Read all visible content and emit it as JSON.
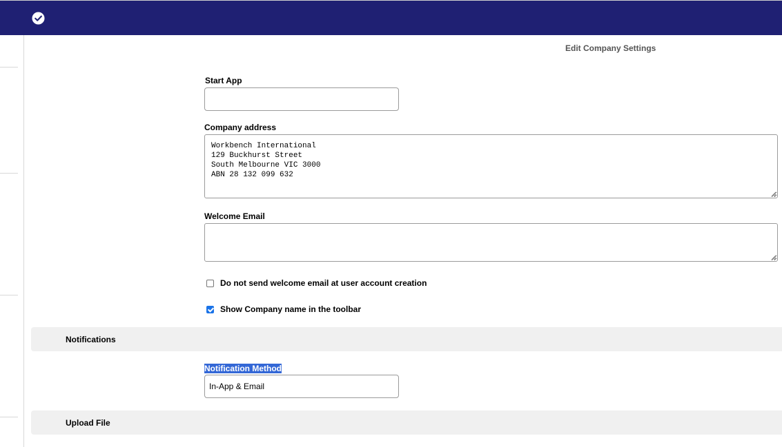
{
  "header": {
    "status_icon": "check-circle-icon",
    "background_color": "#1f2073"
  },
  "page": {
    "title": "Edit Company Settings"
  },
  "form": {
    "start_app": {
      "label": "Start App",
      "value": ""
    },
    "company_address": {
      "label": "Company address",
      "value": "Workbench International\n129 Buckhurst Street\nSouth Melbourne VIC 3000\nABN 28 132 099 632"
    },
    "welcome_email": {
      "label": "Welcome Email",
      "value": ""
    },
    "no_welcome_email": {
      "label": "Do not send welcome email at user account creation",
      "checked": false
    },
    "show_company_name": {
      "label": "Show Company name in the toolbar",
      "checked": true
    }
  },
  "notifications": {
    "section_title": "Notifications",
    "method_label": "Notification Method",
    "method_value": "In-App & Email"
  },
  "upload": {
    "section_title": "Upload File"
  },
  "colors": {
    "accent": "#1a73e8",
    "selection": "#3367d6",
    "section_band": "#f0f0f0"
  }
}
